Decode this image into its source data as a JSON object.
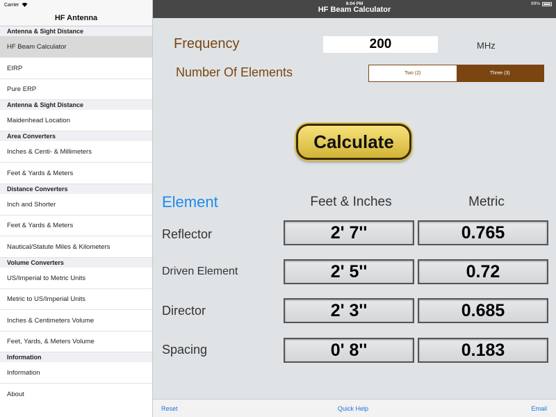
{
  "status": {
    "carrier": "Carrier",
    "time": "8:04 PM",
    "battery": "99%"
  },
  "sidebar": {
    "title": "HF Antenna",
    "sections": [
      {
        "header": "Antenna & Sight Distance",
        "items": [
          "HF Beam Calculator",
          "EIRP",
          "Pure ERP"
        ]
      },
      {
        "header": "Antenna & Sight Distance",
        "items": [
          "Maidenhead Location"
        ]
      },
      {
        "header": "Area Converters",
        "items": [
          "Inches & Centi- & Millimeters",
          "Feet & Yards & Meters"
        ]
      },
      {
        "header": "Distance Converters",
        "items": [
          "Inch and Shorter",
          "Feet & Yards & Meters",
          "Nautical/Statute Miles & Kilometers"
        ]
      },
      {
        "header": "Volume Converters",
        "items": [
          "US/Imperial to Metric Units",
          "Metric to US/Imperial Units",
          "Inches & Centimeters Volume",
          "Feet, Yards, & Meters Volume"
        ]
      },
      {
        "header": "Information",
        "items": [
          "Information",
          "About"
        ]
      }
    ],
    "selected": "HF Beam Calculator"
  },
  "nav": {
    "title": "HF Beam Calculator"
  },
  "form": {
    "frequency_label": "Frequency",
    "frequency_value": "200",
    "unit": "MHz",
    "elements_label": "Number Of Elements",
    "segments": [
      "Two (2)",
      "Three (3)"
    ],
    "selected_segment": "Three (3)"
  },
  "calculate_label": "Calculate",
  "results": {
    "headers": {
      "element": "Element",
      "feet": "Feet & Inches",
      "metric": "Metric"
    },
    "rows": [
      {
        "label": "Reflector",
        "feet": "2' 7''",
        "metric": "0.765"
      },
      {
        "label": "Driven Element",
        "feet": "2' 5''",
        "metric": "0.72"
      },
      {
        "label": "Director",
        "feet": "2' 3''",
        "metric": "0.685"
      },
      {
        "label": "Spacing",
        "feet": "0' 8''",
        "metric": "0.183"
      }
    ]
  },
  "toolbar": {
    "reset": "Reset",
    "help": "Quick Help",
    "email": "Email"
  },
  "colors": {
    "accent_brown": "#7b4512",
    "link_blue": "#1e73d9",
    "header_blue": "#1e8aeb",
    "nav_dark": "#474747"
  }
}
